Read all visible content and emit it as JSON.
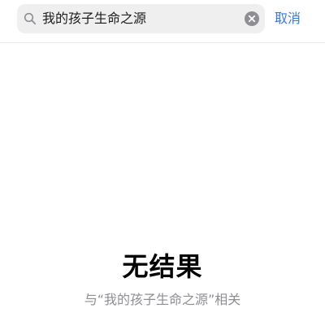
{
  "search": {
    "value": "我的孩子生命之源",
    "icon": "search-icon",
    "clear_icon": "clear-icon",
    "cancel_label": "取消"
  },
  "empty_state": {
    "title": "无结果",
    "subtitle": "与“我的孩子生命之源”相关"
  },
  "colors": {
    "accent": "#3478f6",
    "search_field_bg": "#efeff0",
    "subtitle_text": "#8e8e93"
  }
}
